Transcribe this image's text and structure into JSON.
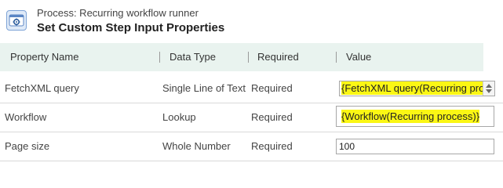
{
  "header": {
    "process_label": "Process: Recurring workflow runner",
    "title": "Set Custom Step Input Properties",
    "icon": "process-gear-icon"
  },
  "grid": {
    "columns": [
      "Property Name",
      "Data Type",
      "Required",
      "Value"
    ],
    "rows": [
      {
        "property": "FetchXML query",
        "data_type": "Single Line of Text",
        "required": "Required",
        "value": "{FetchXML query(Recurring pro"
      },
      {
        "property": "Workflow",
        "data_type": "Lookup",
        "required": "Required",
        "value": "{Workflow(Recurring process)}"
      },
      {
        "property": "Page size",
        "data_type": "Whole Number",
        "required": "Required",
        "value": "100"
      }
    ]
  },
  "colors": {
    "highlight": "#fbf714",
    "header_bg": "#e9f3ef"
  }
}
